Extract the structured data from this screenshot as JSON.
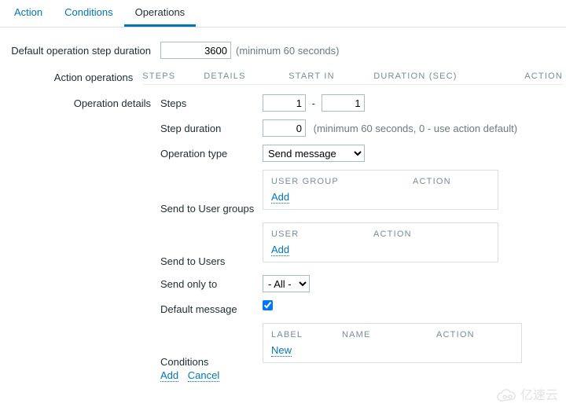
{
  "tabs": {
    "action": "Action",
    "conditions": "Conditions",
    "operations": "Operations"
  },
  "step_duration": {
    "label": "Default operation step duration",
    "value": "3600",
    "hint": "(minimum 60 seconds)"
  },
  "action_ops": {
    "label": "Action operations",
    "head": {
      "steps": "STEPS",
      "details": "DETAILS",
      "start": "START IN",
      "duration": "DURATION (SEC)",
      "action": "ACTION"
    }
  },
  "details": {
    "label": "Operation details",
    "steps": {
      "label": "Steps",
      "from": "1",
      "to": "1"
    },
    "dur": {
      "label": "Step duration",
      "value": "0",
      "hint": "(minimum 60 seconds, 0 - use action default)"
    },
    "type": {
      "label": "Operation type",
      "value": "Send message"
    },
    "usergroups": {
      "label": "Send to User groups",
      "head": {
        "c1": "USER GROUP",
        "c2": "ACTION"
      },
      "add": "Add"
    },
    "users": {
      "label": "Send to Users",
      "head": {
        "c1": "USER",
        "c2": "ACTION"
      },
      "add": "Add"
    },
    "only": {
      "label": "Send only to",
      "value": "- All -"
    },
    "defmsg": {
      "label": "Default message"
    },
    "conditions": {
      "label": "Conditions",
      "head": {
        "c1": "LABEL",
        "c2": "NAME",
        "c3": "ACTION"
      },
      "new": "New"
    },
    "actions": {
      "add": "Add",
      "cancel": "Cancel"
    }
  },
  "watermark": "亿速云"
}
